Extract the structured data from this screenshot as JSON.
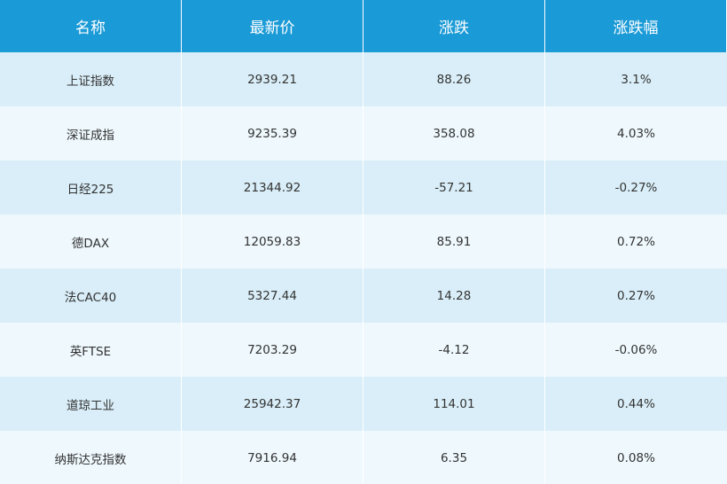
{
  "headers": [
    "名称",
    "最新价",
    "涨跌",
    "涨跌幅"
  ],
  "rows": [
    [
      "上证指数",
      "2939.21",
      "88.26",
      "3.1%"
    ],
    [
      "深证成指",
      "9235.39",
      "358.08",
      "4.03%"
    ],
    [
      "日经225",
      "21344.92",
      "-57.21",
      "-0.27%"
    ],
    [
      "德DAX",
      "12059.83",
      "85.91",
      "0.72%"
    ],
    [
      "法CAC40",
      "5327.44",
      "14.28",
      "0.27%"
    ],
    [
      "英FTSE",
      "7203.29",
      "-4.12",
      "-0.06%"
    ],
    [
      "道琼工业",
      "25942.37",
      "114.01",
      "0.44%"
    ],
    [
      "纳斯达克指数",
      "7916.94",
      "6.35",
      "0.08%"
    ]
  ],
  "colors": {
    "header_bg": "#1a9ad6",
    "row_odd": "#d9eef8",
    "row_even": "#eef8fd",
    "text": "#333333"
  }
}
